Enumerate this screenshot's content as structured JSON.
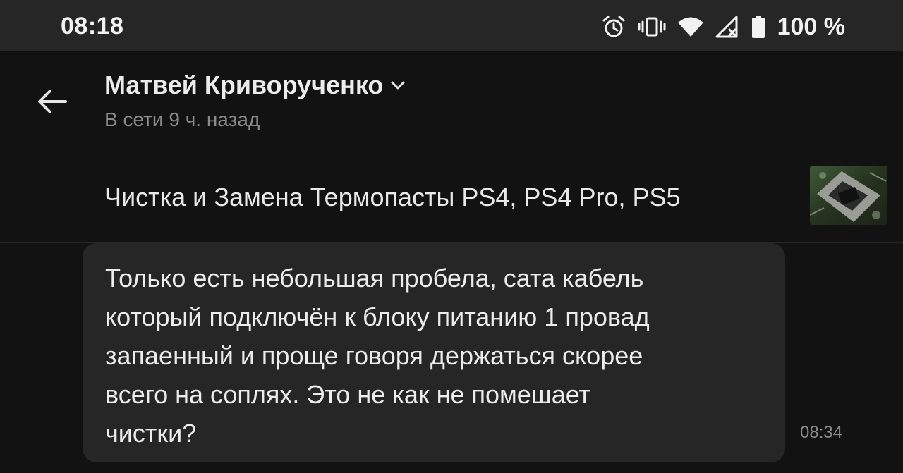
{
  "status_bar": {
    "time": "08:18",
    "battery": "100 %",
    "icons": [
      "alarm-icon",
      "vibrate-icon",
      "wifi-icon",
      "signal-icon",
      "battery-icon"
    ]
  },
  "header": {
    "back_icon": "arrow-left-icon",
    "contact_name": "Матвей Криворученко",
    "dropdown_icon": "chevron-down-icon",
    "status": "В сети 9 ч. назад"
  },
  "listing": {
    "title": "Чистка и Замена Термопасты PS4, PS4 Pro, PS5"
  },
  "messages": [
    {
      "text": "Только есть небольшая пробела, сата кабель\nкоторый подключён к блоку питанию 1 провад\nзапаенный и проще говоря держаться скорее\nвсего на соплях. Это не как не помешает\nчистки?",
      "time": "08:34"
    }
  ],
  "colors": {
    "background": "#121212",
    "status_bar": "#262626",
    "bubble": "#262626",
    "primary_text": "#ececec",
    "secondary_text": "#8a8a8a"
  }
}
